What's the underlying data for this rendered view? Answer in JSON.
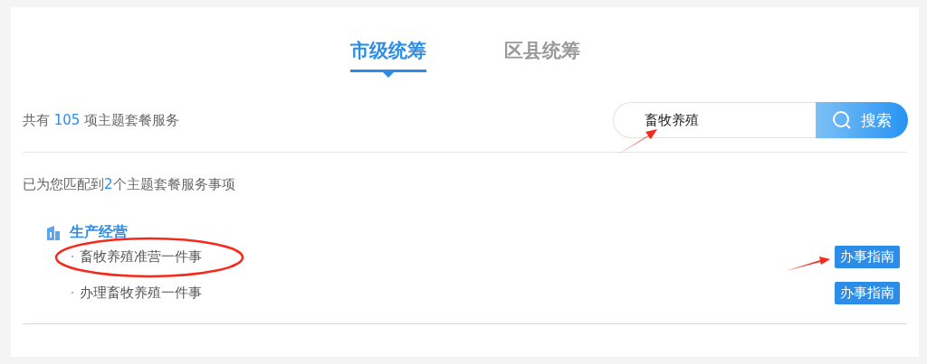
{
  "tabs": [
    {
      "label": "市级统筹",
      "selected": true
    },
    {
      "label": "区县统筹",
      "selected": false
    }
  ],
  "summary": {
    "prefix": "共有",
    "count": "105",
    "suffix": "项主题套餐服务"
  },
  "search": {
    "value": "畜牧养殖",
    "button": "搜索"
  },
  "result": {
    "prefix": "已为您匹配到",
    "count": "2",
    "suffix": "个主题套餐服务事项"
  },
  "category": {
    "title": "生产经营",
    "items": [
      {
        "name": "畜牧养殖准营一件事",
        "action": "办事指南"
      },
      {
        "name": "办理畜牧养殖一件事",
        "action": "办事指南"
      }
    ]
  }
}
